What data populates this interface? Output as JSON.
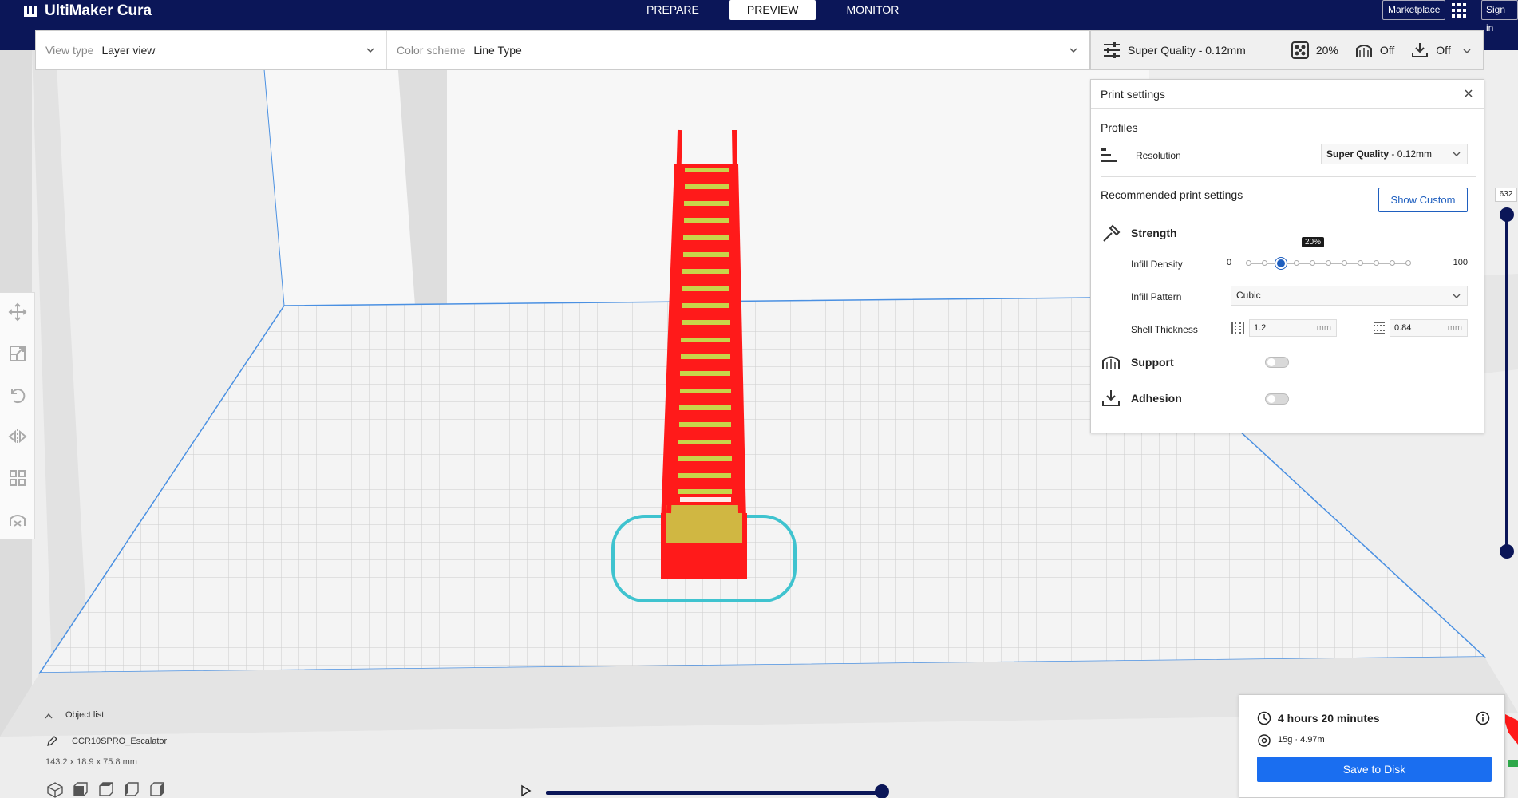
{
  "app": {
    "title": "UltiMaker Cura"
  },
  "stages": [
    {
      "label": "PREPARE",
      "active": false
    },
    {
      "label": "PREVIEW",
      "active": true
    },
    {
      "label": "MONITOR",
      "active": false
    }
  ],
  "topright": {
    "marketplace": "Marketplace",
    "signin": "Sign in"
  },
  "header": {
    "view_type_label": "View type",
    "view_type_value": "Layer view",
    "color_scheme_label": "Color scheme",
    "color_scheme_value": "Line Type"
  },
  "quality_bar": {
    "profile": "Super Quality - 0.12mm",
    "infill": "20%",
    "support": "Off",
    "adhesion": "Off"
  },
  "print_settings": {
    "title": "Print settings",
    "profiles_label": "Profiles",
    "resolution_label": "Resolution",
    "resolution_bold": "Super Quality",
    "resolution_rest": " - 0.12mm",
    "recommended_label": "Recommended print settings",
    "show_custom": "Show Custom",
    "strength_title": "Strength",
    "infill_density_label": "Infill Density",
    "infill_min": "0",
    "infill_max": "100",
    "infill_value": 20,
    "infill_tooltip": "20%",
    "infill_pattern_label": "Infill Pattern",
    "infill_pattern_value": "Cubic",
    "shell_thickness_label": "Shell Thickness",
    "wall_thickness": "1.2",
    "topbottom_thickness": "0.84",
    "unit": "mm",
    "support_title": "Support",
    "support_on": false,
    "adhesion_title": "Adhesion",
    "adhesion_on": false
  },
  "layer_slider": {
    "value": "632"
  },
  "object_list": {
    "label": "Object list",
    "object_name": "CCR10SPRO_Escalator",
    "dimensions": "143.2 x 18.9 x 75.8 mm"
  },
  "job": {
    "time": "4 hours 20 minutes",
    "material": "15g · 4.97m",
    "save_label": "Save to Disk"
  },
  "colors": {
    "brand_navy": "#0b1658",
    "accent_blue": "#1a6ef0",
    "model_red": "#ff1a1a",
    "model_yellow": "#c8d44a",
    "outline_cyan": "#3fc3cf"
  }
}
